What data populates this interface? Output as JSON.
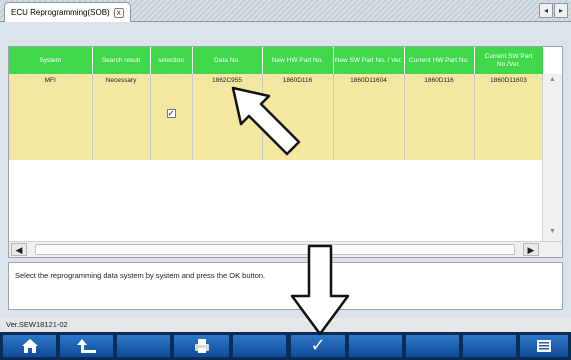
{
  "tab": {
    "title": "ECU Reprogramming(SOB)",
    "close_icon": "close-icon"
  },
  "nav": {
    "prev": "◂",
    "next": "▸"
  },
  "table": {
    "columns": [
      "System",
      "Search result",
      "selection",
      "Data No.",
      "New HW Part No.",
      "New SW Part No. / Ver.",
      "Current HW Part No.",
      "Current SW Part No./Ver."
    ],
    "rows": [
      {
        "system": "MFI",
        "search_result": "Necessary",
        "selection": "✓",
        "data_no": "1862C955",
        "new_hw": "1860D116",
        "new_sw": "1860D11604",
        "cur_hw": "1860D116",
        "cur_sw": "1860D11603"
      }
    ]
  },
  "message": "Select the reprogramming data system by system and press the OK button.",
  "status": {
    "version": "Ver.SEW18121-02"
  },
  "toolbar": {
    "buttons": [
      "home-icon",
      "back-icon",
      "blank",
      "print-icon",
      "blank",
      "ok-check-icon",
      "blank",
      "blank",
      "notes-icon"
    ],
    "ok_symbol": "✓"
  }
}
